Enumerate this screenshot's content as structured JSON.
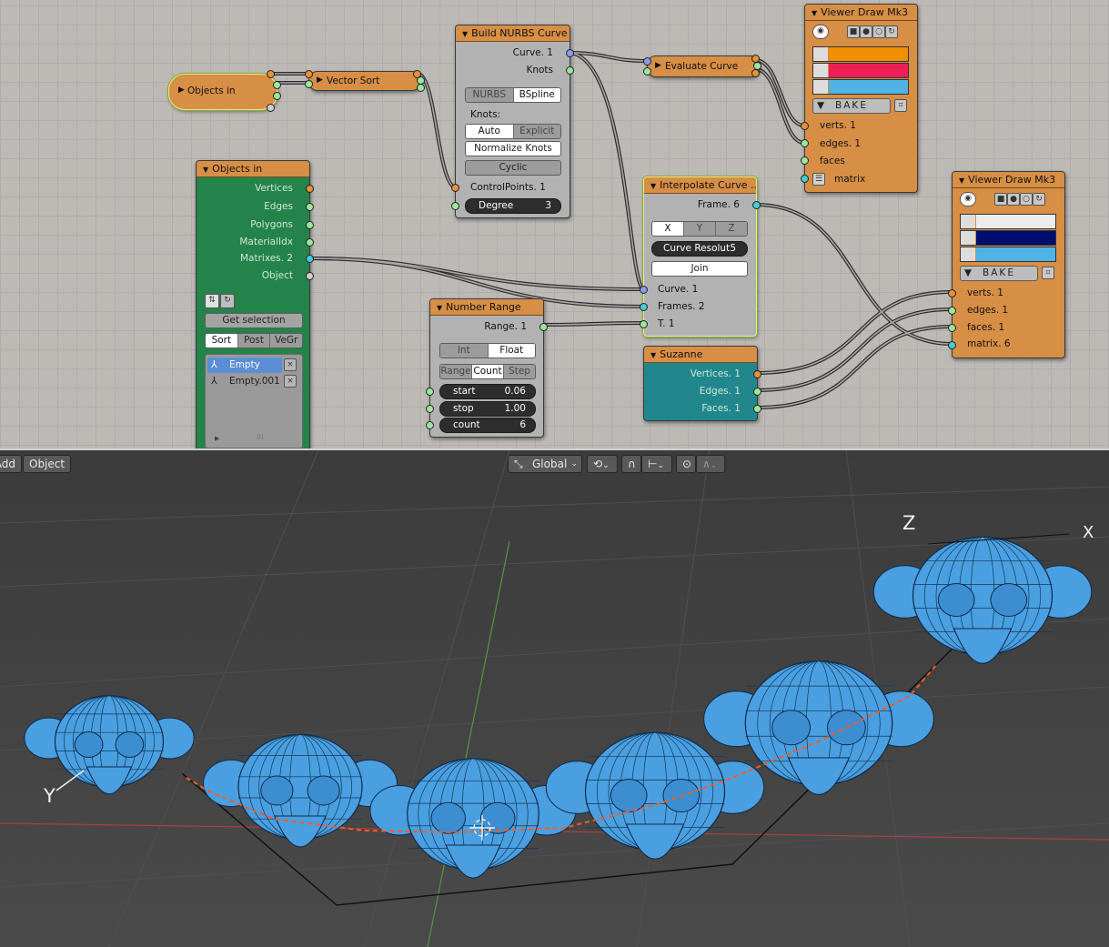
{
  "node_editor": {
    "objects_in_small": {
      "title": "Objects in"
    },
    "vector_sort": {
      "title": "Vector Sort"
    },
    "build_nurbs": {
      "title": "Build NURBS Curve",
      "out_curve": "Curve. 1",
      "out_knots": "Knots",
      "mode_options": [
        "NURBS",
        "BSpline"
      ],
      "mode_selected": "BSpline",
      "knots_label": "Knots:",
      "knots_options": [
        "Auto",
        "Explicit"
      ],
      "knots_selected": "Auto",
      "normalize_label": "Normalize Knots",
      "cyclic_label": "Cyclic",
      "in_control": "ControlPoints. 1",
      "degree_label": "Degree",
      "degree_value": "3"
    },
    "evaluate_curve": {
      "title": "Evaluate Curve"
    },
    "viewer1": {
      "title": "Viewer Draw Mk3",
      "bake_label": "BAKE",
      "colors": [
        "#f09000",
        "#ee1f56",
        "#4fb3e6"
      ],
      "verts": "verts. 1",
      "edges": "edges. 1",
      "faces": "faces",
      "matrix": "matrix"
    },
    "objects_in": {
      "title": "Objects in",
      "outputs": [
        "Vertices",
        "Edges",
        "Polygons",
        "MaterialIdx",
        "Matrixes. 2",
        "Object"
      ],
      "get_selection": "Get selection",
      "sort_tabs": [
        "Sort",
        "Post",
        "VeGr"
      ],
      "sort_selected": "Sort",
      "objects": [
        "Empty",
        "Empty.001"
      ]
    },
    "number_range": {
      "title": "Number Range",
      "out_range": "Range. 1",
      "type_options": [
        "Int",
        "Float"
      ],
      "type_selected": "Float",
      "mode_options": [
        "Range",
        "Count",
        "Step"
      ],
      "mode_selected": "Count",
      "start_label": "start",
      "start_value": "0.06",
      "stop_label": "stop",
      "stop_value": "1.00",
      "count_label": "count",
      "count_value": "6"
    },
    "interpolate": {
      "title": "Interpolate Curve ..",
      "out_frame": "Frame. 6",
      "axis_options": [
        "X",
        "Y",
        "Z"
      ],
      "axis_selected": "X",
      "resolution_label": "Curve Resolut",
      "resolution_value": "5",
      "join_label": "Join",
      "in_curve": "Curve. 1",
      "in_frames": "Frames. 2",
      "in_t": "T. 1"
    },
    "suzanne": {
      "title": "Suzanne",
      "outputs": [
        "Vertices. 1",
        "Edges. 1",
        "Faces. 1"
      ]
    },
    "viewer2": {
      "title": "Viewer Draw Mk3",
      "bake_label": "BAKE",
      "colors": [
        "#ececec",
        "#000d70",
        "#4fb3e6"
      ],
      "verts": "verts. 1",
      "edges": "edges. 1",
      "faces": "faces. 1",
      "matrix": "matrix. 6"
    }
  },
  "viewport": {
    "menu_add": "Add",
    "menu_object": "Object",
    "orientation": "Global",
    "axis_labels": {
      "x": "X",
      "y": "Y",
      "z": "Z"
    },
    "mesh_color": "#4a9fe0"
  }
}
